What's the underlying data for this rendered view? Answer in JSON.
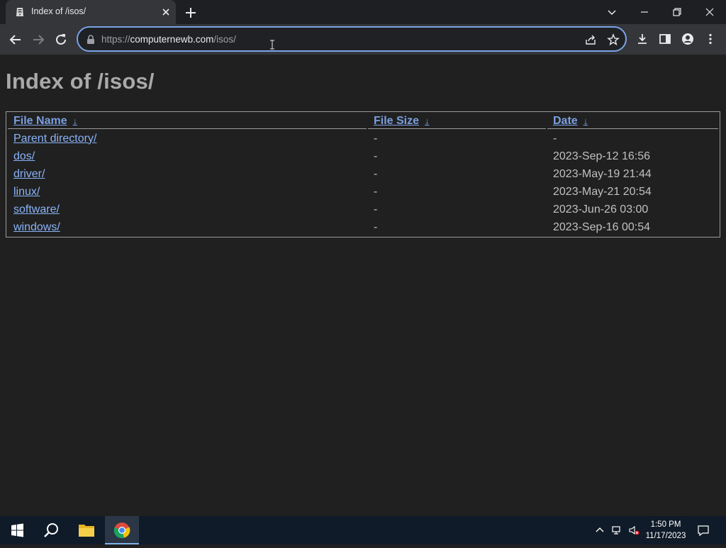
{
  "browser": {
    "tab_title": "Index of /isos/",
    "url_scheme": "https://",
    "url_host": "computernewb.com",
    "url_path": "/isos/"
  },
  "page": {
    "heading": "Index of /isos/",
    "columns": {
      "name": "File Name",
      "size": "File Size",
      "date": "Date",
      "sort_arrow": "↓"
    },
    "rows": [
      {
        "name": "Parent directory/",
        "size": "-",
        "date": "-"
      },
      {
        "name": "dos/",
        "size": "-",
        "date": "2023-Sep-12 16:56"
      },
      {
        "name": "driver/",
        "size": "-",
        "date": "2023-May-19 21:44"
      },
      {
        "name": "linux/",
        "size": "-",
        "date": "2023-May-21 20:54"
      },
      {
        "name": "software/",
        "size": "-",
        "date": "2023-Jun-26 03:00"
      },
      {
        "name": "windows/",
        "size": "-",
        "date": "2023-Sep-16 00:54"
      }
    ]
  },
  "taskbar": {
    "time": "1:50 PM",
    "date": "11/17/2023"
  },
  "colors": {
    "link": "#8ab4f8",
    "omnibox_focus": "#7aa3e8",
    "page_background": "#202020",
    "taskbar": "#101b29"
  },
  "icons": {
    "tab_favicon": "server-tower-icon",
    "new_tab": "plus-icon",
    "back": "arrow-left-icon",
    "forward": "arrow-right-icon",
    "reload": "reload-icon",
    "lock": "lock-icon",
    "share": "share-icon",
    "bookmark": "star-icon",
    "download": "download-icon",
    "side_panel": "side-panel-icon",
    "profile": "profile-icon",
    "menu": "kebab-menu-icon"
  }
}
